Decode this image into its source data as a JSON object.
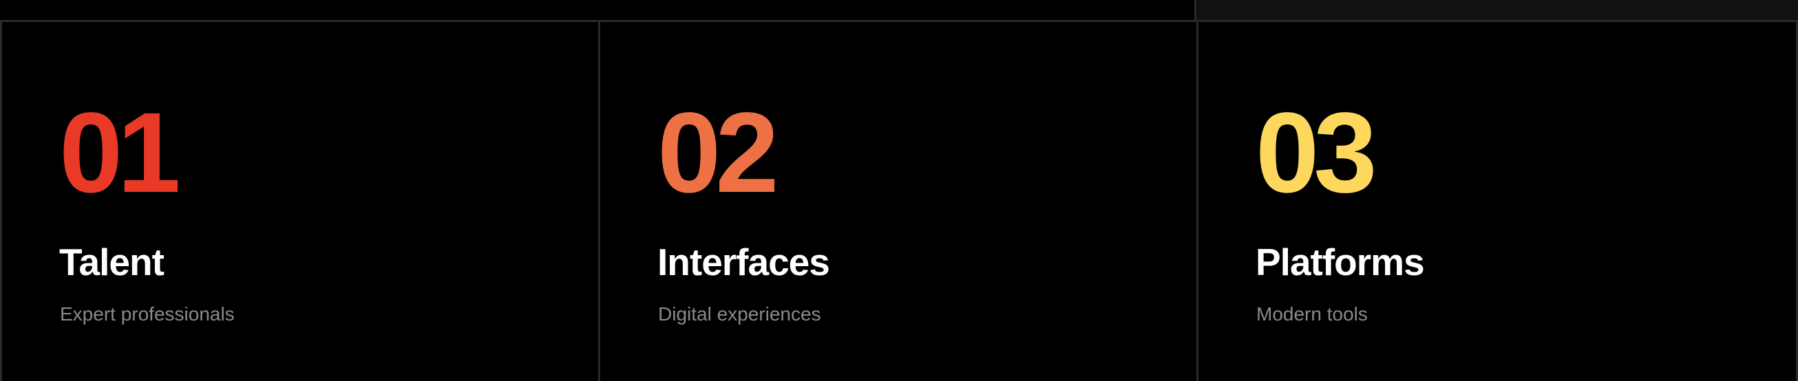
{
  "cards": [
    {
      "number": "01",
      "title": "Talent",
      "subtitle": "Expert professionals",
      "color": "#e83a27"
    },
    {
      "number": "02",
      "title": "Interfaces",
      "subtitle": "Digital experiences",
      "color": "#ee7145"
    },
    {
      "number": "03",
      "title": "Platforms",
      "subtitle": "Modern tools",
      "color": "#fdd85d"
    }
  ]
}
